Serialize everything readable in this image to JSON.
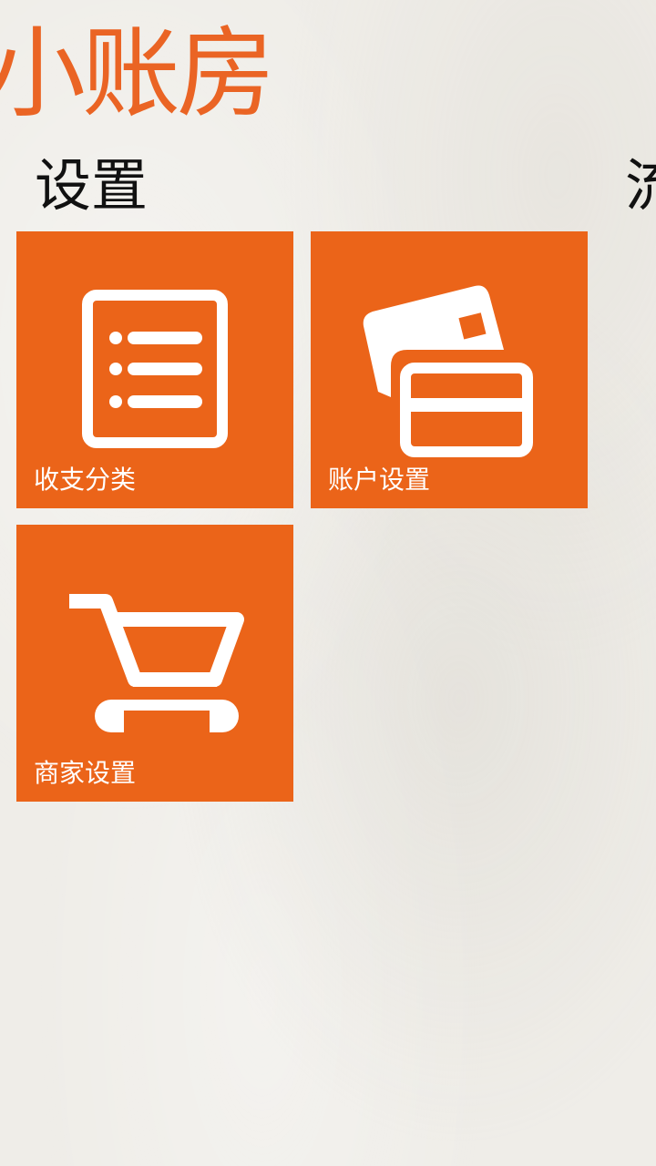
{
  "app": {
    "title": "小账房"
  },
  "sections": {
    "settings": {
      "title": "设置"
    },
    "next": {
      "title": "流"
    }
  },
  "tiles": [
    {
      "label": "收支分类",
      "icon": "list-icon",
      "color": "#eb6419"
    },
    {
      "label": "账户设置",
      "icon": "credit-card-icon",
      "color": "#eb6419"
    },
    {
      "label": "商家设置",
      "icon": "shopping-cart-icon",
      "color": "#eb6419"
    }
  ],
  "colors": {
    "accent": "#ea6424",
    "tile": "#eb6419",
    "background": "#efede8"
  }
}
